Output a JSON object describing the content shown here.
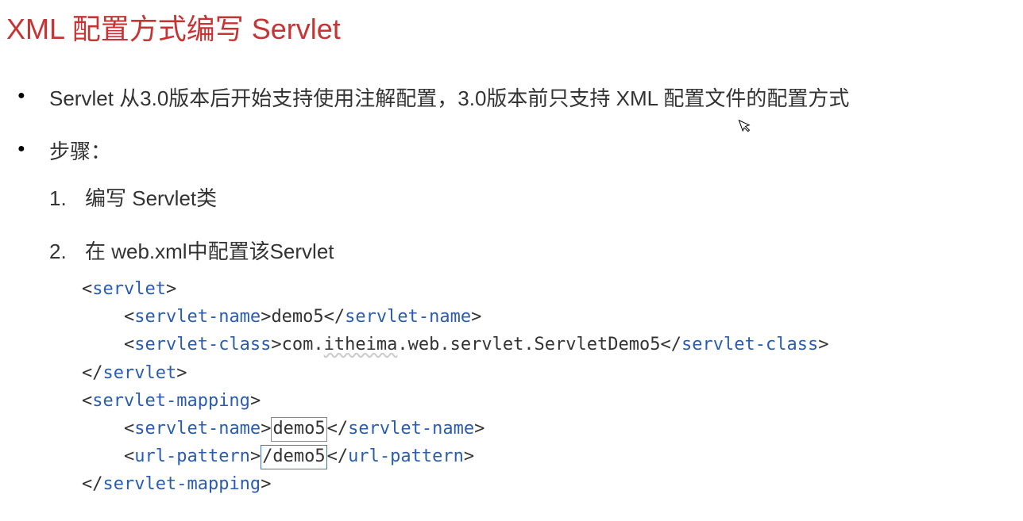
{
  "title": "XML 配置方式编写 Servlet",
  "bullet1": "Servlet 从3.0版本后开始支持使用注解配置，3.0版本前只支持 XML 配置文件的配置方式",
  "bullet2": "步骤：",
  "step1": "编写 Servlet类",
  "step2": "在 web.xml中配置该Servlet",
  "code": {
    "servlet_open": "servlet",
    "servlet_name_tag": "servlet-name",
    "servlet_name_val": "demo5",
    "servlet_class_tag": "servlet-class",
    "servlet_class_val1": "com.",
    "servlet_class_val2": "itheima",
    "servlet_class_val3": ".web.servlet.ServletDemo5",
    "servlet_mapping_tag": "servlet-mapping",
    "url_pattern_tag": "url-pattern",
    "url_pattern_val": "/demo5"
  }
}
